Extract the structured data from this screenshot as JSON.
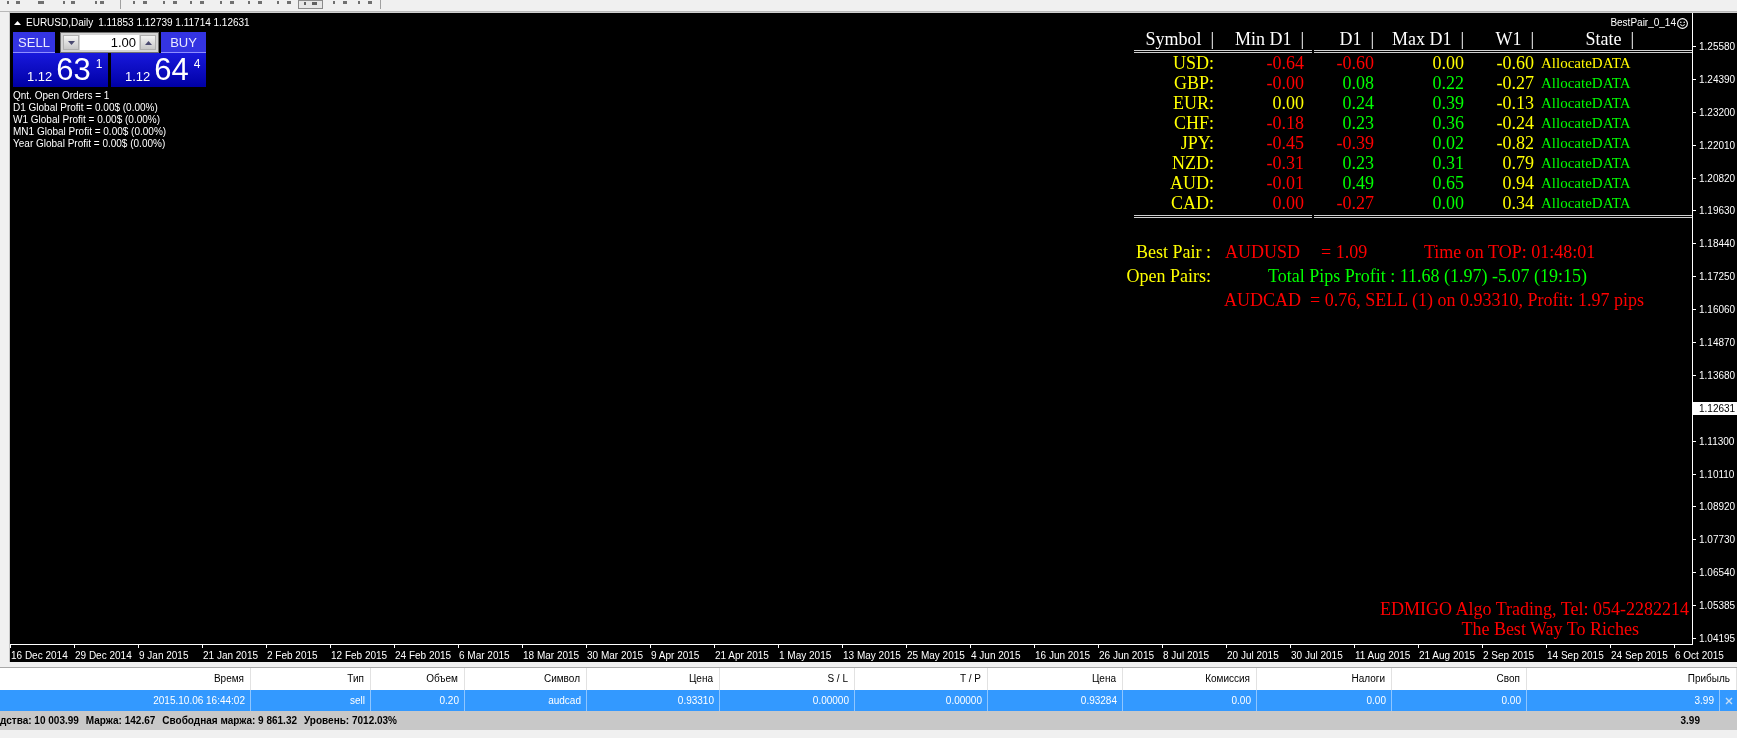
{
  "chart": {
    "title": {
      "symbol": "EURUSD,Daily",
      "quotes": "1.11853 1.12739 1.11714 1.12631"
    },
    "trade_panel": {
      "sell_label": "SELL",
      "lot": "1.00",
      "buy_label": "BUY",
      "sell_price": {
        "prefix": "1.12",
        "main": "63",
        "point": "1"
      },
      "buy_price": {
        "prefix": "1.12",
        "main": "64",
        "point": "4"
      }
    },
    "account_info": [
      "Qnt. Open Orders = 1",
      "D1 Global Profit = 0.00$ (0.00%)",
      "W1 Global Profit = 0.00$ (0.00%)",
      "MN1 Global Profit = 0.00$ (0.00%)",
      "Year Global Profit = 0.00$ (0.00%)"
    ],
    "indicator_name": "BestPair_0_14",
    "strength_table": {
      "columns": [
        "Symbol  |",
        "Min D1  |",
        "D1  |",
        "Max D1  |",
        "W1  |",
        "State  |"
      ],
      "rows": [
        {
          "cells": [
            {
              "text": "USD:",
              "color": "#ffff00"
            },
            {
              "text": "-0.64",
              "color": "#ff0000"
            },
            {
              "text": "-0.60",
              "color": "#ff0000"
            },
            {
              "text": "0.00",
              "color": "#ffff00"
            },
            {
              "text": "-0.60",
              "color": "#ffff00"
            },
            {
              "text": "AllocateDATA",
              "color": "#ffff00"
            }
          ]
        },
        {
          "cells": [
            {
              "text": "GBP:",
              "color": "#ffff00"
            },
            {
              "text": "-0.00",
              "color": "#ff0000"
            },
            {
              "text": "0.08",
              "color": "#00ff00"
            },
            {
              "text": "0.22",
              "color": "#00ff00"
            },
            {
              "text": "-0.27",
              "color": "#ffff00"
            },
            {
              "text": "AllocateDATA",
              "color": "#00ff00"
            }
          ]
        },
        {
          "cells": [
            {
              "text": "EUR:",
              "color": "#ffff00"
            },
            {
              "text": "0.00",
              "color": "#ffff00"
            },
            {
              "text": "0.24",
              "color": "#00ff00"
            },
            {
              "text": "0.39",
              "color": "#00ff00"
            },
            {
              "text": "-0.13",
              "color": "#ffff00"
            },
            {
              "text": "AllocateDATA",
              "color": "#00ff00"
            }
          ]
        },
        {
          "cells": [
            {
              "text": "CHF:",
              "color": "#ffff00"
            },
            {
              "text": "-0.18",
              "color": "#ff0000"
            },
            {
              "text": "0.23",
              "color": "#00ff00"
            },
            {
              "text": "0.36",
              "color": "#00ff00"
            },
            {
              "text": "-0.24",
              "color": "#ffff00"
            },
            {
              "text": "AllocateDATA",
              "color": "#00ff00"
            }
          ]
        },
        {
          "cells": [
            {
              "text": "JPY:",
              "color": "#ffff00"
            },
            {
              "text": "-0.45",
              "color": "#ff0000"
            },
            {
              "text": "-0.39",
              "color": "#ff0000"
            },
            {
              "text": "0.02",
              "color": "#00ff00"
            },
            {
              "text": "-0.82",
              "color": "#ffff00"
            },
            {
              "text": "AllocateDATA",
              "color": "#00ff00"
            }
          ]
        },
        {
          "cells": [
            {
              "text": "NZD:",
              "color": "#ffff00"
            },
            {
              "text": "-0.31",
              "color": "#ff0000"
            },
            {
              "text": "0.23",
              "color": "#00ff00"
            },
            {
              "text": "0.31",
              "color": "#00ff00"
            },
            {
              "text": "0.79",
              "color": "#ffff00"
            },
            {
              "text": "AllocateDATA",
              "color": "#00ff00"
            }
          ]
        },
        {
          "cells": [
            {
              "text": "AUD:",
              "color": "#ffff00"
            },
            {
              "text": "-0.01",
              "color": "#ff0000"
            },
            {
              "text": "0.49",
              "color": "#00ff00"
            },
            {
              "text": "0.65",
              "color": "#00ff00"
            },
            {
              "text": "0.94",
              "color": "#ffff00"
            },
            {
              "text": "AllocateDATA",
              "color": "#00ff00"
            }
          ]
        },
        {
          "cells": [
            {
              "text": "CAD:",
              "color": "#ffff00"
            },
            {
              "text": "0.00",
              "color": "#ff0000"
            },
            {
              "text": "-0.27",
              "color": "#ff0000"
            },
            {
              "text": "0.00",
              "color": "#00ff00"
            },
            {
              "text": "0.34",
              "color": "#ffff00"
            },
            {
              "text": "AllocateDATA",
              "color": "#00ff00"
            }
          ]
        }
      ]
    },
    "best_pair": {
      "label": "Best Pair :",
      "symbol": "AUDUSD",
      "value": "= 1.09",
      "time_on_top": "Time on TOP: 01:48:01"
    },
    "open_pairs": {
      "label": "Open Pairs:",
      "total": "Total Pips Profit : 11.68 (1.97) -5.07 (19:15)",
      "positions": [
        "AUDCAD  = 0.76, SELL (1) on 0.93310, Profit: 1.97 pips"
      ]
    },
    "footer": {
      "contact": "EDMIGO Algo Trading, Tel: 054-2282214",
      "slogan": "The Best Way To Riches"
    },
    "price_axis": [
      {
        "kind": "tick",
        "text": "1.25580"
      },
      {
        "kind": "tick",
        "text": "1.24390"
      },
      {
        "kind": "tick",
        "text": "1.23200"
      },
      {
        "kind": "tick",
        "text": "1.22010"
      },
      {
        "kind": "tick",
        "text": "1.20820"
      },
      {
        "kind": "tick",
        "text": "1.19630"
      },
      {
        "kind": "tick",
        "text": "1.18440"
      },
      {
        "kind": "tick",
        "text": "1.17250"
      },
      {
        "kind": "tick",
        "text": "1.16060"
      },
      {
        "kind": "tick",
        "text": "1.14870"
      },
      {
        "kind": "tick",
        "text": "1.13680"
      },
      {
        "kind": "current",
        "text": "1.12631"
      },
      {
        "kind": "tick",
        "text": "1.11300"
      },
      {
        "kind": "tick",
        "text": "1.10110"
      },
      {
        "kind": "tick",
        "text": "1.08920"
      },
      {
        "kind": "tick",
        "text": "1.07730"
      },
      {
        "kind": "tick",
        "text": "1.06540"
      },
      {
        "kind": "tick",
        "text": "1.05385"
      },
      {
        "kind": "tick",
        "text": "1.04195"
      }
    ],
    "time_axis": [
      "16 Dec 2014",
      "29 Dec 2014",
      "9 Jan 2015",
      "21 Jan 2015",
      "2 Feb 2015",
      "12 Feb 2015",
      "24 Feb 2015",
      "6 Mar 2015",
      "18 Mar 2015",
      "30 Mar 2015",
      "9 Apr 2015",
      "21 Apr 2015",
      "1 May 2015",
      "13 May 2015",
      "25 May 2015",
      "4 Jun 2015",
      "16 Jun 2015",
      "26 Jun 2015",
      "8 Jul 2015",
      "20 Jul 2015",
      "30 Jul 2015",
      "11 Aug 2015",
      "21 Aug 2015",
      "2 Sep 2015",
      "14 Sep 2015",
      "24 Sep 2015",
      "6 Oct 2015"
    ]
  },
  "terminal": {
    "columns": [
      "Время",
      "Тип",
      "Объем",
      "Символ",
      "Цена",
      "S / L",
      "T / P",
      "Цена",
      "Комиссия",
      "Налоги",
      "Своп",
      "Прибыль"
    ],
    "rows": [
      {
        "selected": true,
        "cells": [
          "2015.10.06 16:44:02",
          "sell",
          "0.20",
          "audcad",
          "0.93310",
          "0.00000",
          "0.00000",
          "0.93284",
          "0.00",
          "0.00",
          "0.00",
          "3.99"
        ]
      }
    ],
    "status_bar": {
      "items": [
        "дства: 10 003.99",
        "Маржа: 142.67",
        "Свободная маржа: 9 861.32",
        "Уровень: 7012.03%"
      ],
      "total": "3.99"
    }
  }
}
